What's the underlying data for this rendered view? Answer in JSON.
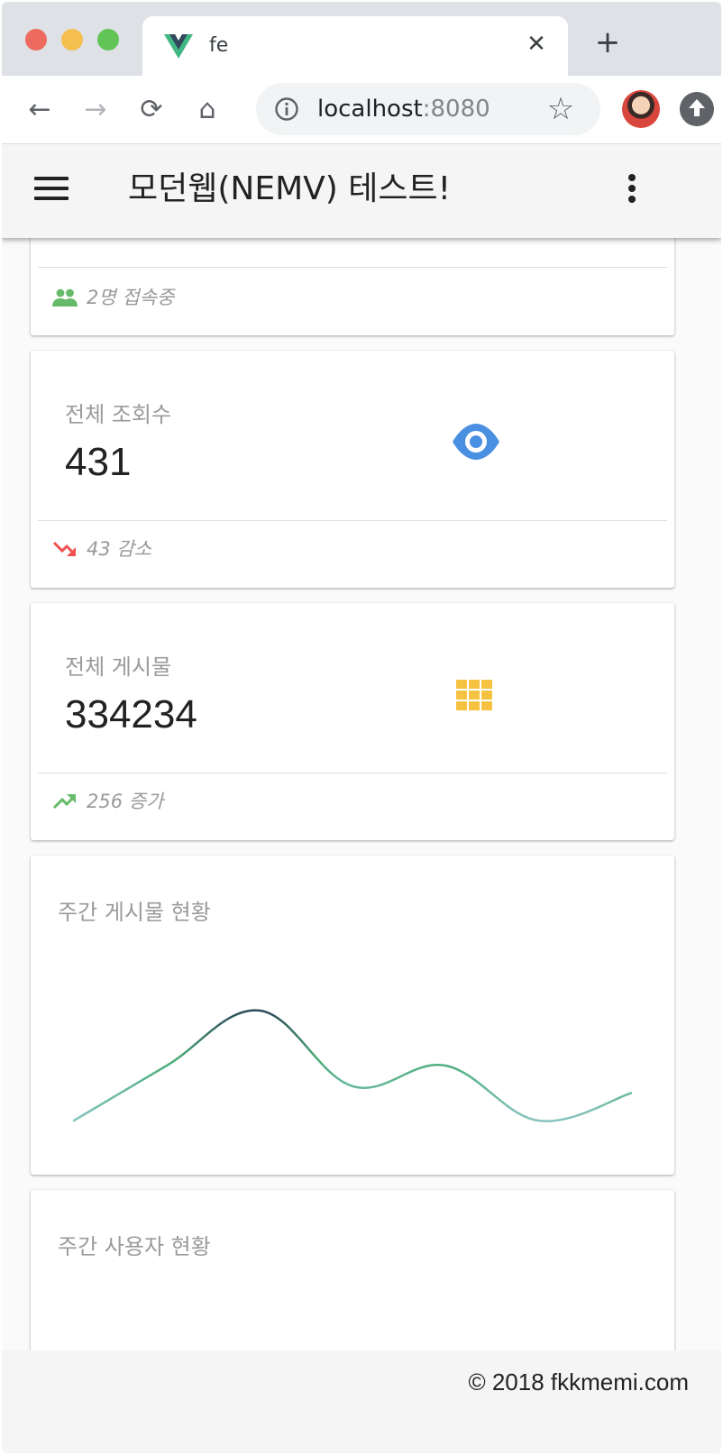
{
  "browser": {
    "tab_title": "fe",
    "tab_close": "✕",
    "new_tab": "+",
    "url_host": "localhost",
    "url_port": ":8080",
    "back": "←",
    "forward": "→",
    "reload": "⟳",
    "home": "⌂",
    "star": "☆"
  },
  "app": {
    "title": "모던웹(NEMV) 테스트!"
  },
  "cards": {
    "users": {
      "footer": "2명 접속중",
      "footer_color": "#66bb6a"
    },
    "views": {
      "label": "전체 조회수",
      "value": "431",
      "footer": "43 감소",
      "icon": "eye-icon",
      "icon_color": "#4a90e2",
      "trend_color": "#ef5350"
    },
    "posts": {
      "label": "전체 게시물",
      "value": "334234",
      "footer": "256 증가",
      "icon": "grid-icon",
      "icon_color": "#f5c242",
      "trend_color": "#66bb6a"
    },
    "weekly_posts": {
      "title": "주간 게시물 현황"
    },
    "weekly_users": {
      "title": "주간 사용자 현황"
    }
  },
  "chart_data": {
    "type": "line",
    "title": "주간 게시물 현황",
    "xlabel": "",
    "ylabel": "",
    "grid": false,
    "series": [
      {
        "values": [
          0,
          4,
          8,
          2.5,
          4,
          0,
          2
        ]
      }
    ],
    "ylim": [
      0,
      8
    ],
    "gradient_colors": [
      "#89c4c0",
      "#4cae79",
      "#2e4a5a"
    ]
  },
  "footer": {
    "copyright": "© 2018 fkkmemi.com"
  }
}
